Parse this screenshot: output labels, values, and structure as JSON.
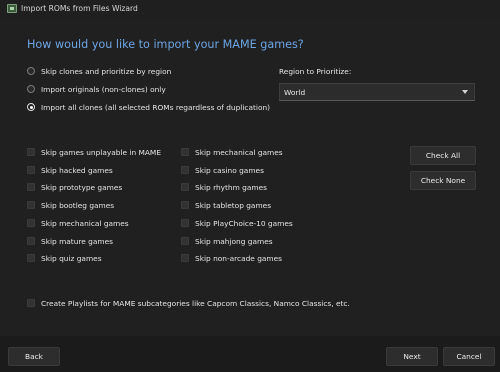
{
  "window": {
    "title": "Import ROMs from Files Wizard",
    "icon": "app-icon"
  },
  "heading": "How would you like to import your MAME games?",
  "import_options": [
    {
      "label": "Skip clones and prioritize by region",
      "selected": false
    },
    {
      "label": "Import originals (non-clones) only",
      "selected": false
    },
    {
      "label": "Import all clones (all selected ROMs regardless of duplication)",
      "selected": true
    }
  ],
  "region": {
    "label": "Region to Prioritize:",
    "value": "World"
  },
  "skip_options_left": [
    "Skip games unplayable in MAME",
    "Skip hacked games",
    "Skip prototype games",
    "Skip bootleg games",
    "Skip mechanical games",
    "Skip mature games",
    "Skip quiz games"
  ],
  "skip_options_right": [
    "Skip mechanical games",
    "Skip casino games",
    "Skip rhythm games",
    "Skip tabletop games",
    "Skip PlayChoice-10 games",
    "Skip mahjong games",
    "Skip non-arcade games"
  ],
  "check_all_label": "Check All",
  "check_none_label": "Check None",
  "playlists_option": "Create Playlists for MAME subcategories like Capcom Classics, Namco Classics, etc.",
  "footer": {
    "back_label": "Back",
    "next_label": "Next",
    "cancel_label": "Cancel"
  },
  "colors": {
    "accent": "#6ea6e6",
    "background": "#202020",
    "button": "#2d2d2d"
  }
}
